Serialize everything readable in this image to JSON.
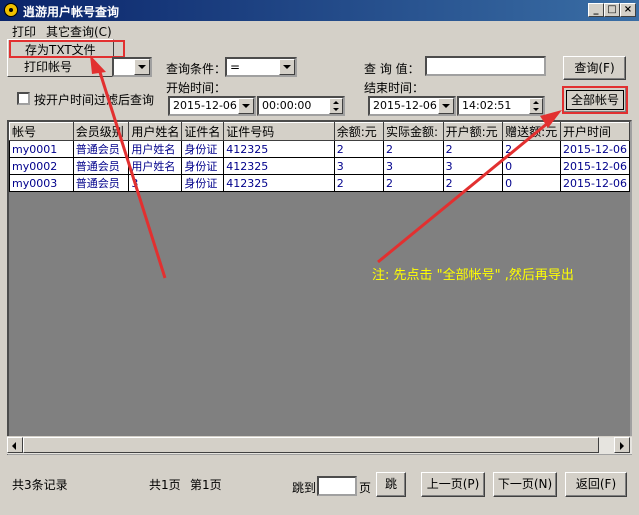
{
  "window": {
    "title": "逍游用户帐号查询",
    "min": "_",
    "max": "□",
    "close": "×"
  },
  "menu": [
    {
      "label": "打印"
    },
    {
      "label": "其它查询(C)"
    }
  ],
  "print_menu": [
    {
      "label": "存为TXT文件"
    },
    {
      "label": "打印帐号"
    }
  ],
  "query": {
    "condition_label": "查询条件：",
    "condition_value": "=",
    "value_label": "查 询 值：",
    "value_text": "",
    "query_button": "查询(F)",
    "all_accounts_button": "全部帐号",
    "filter_checkbox_label": "按开户时间过滤后查询",
    "start_label": "开始时间：",
    "start_date": "2015-12-06",
    "start_time": "00:00:00",
    "end_label": "结束时间：",
    "end_date": "2015-12-06",
    "end_time": "14:02:51"
  },
  "table": {
    "columns": [
      "帐号",
      "会员级别",
      "用户姓名",
      "证件名",
      "证件号码",
      "余额:元",
      "实际金额:",
      "开户额:元",
      "赠送额:元",
      "开户时间"
    ],
    "rows": [
      [
        "my0001",
        "普通会员",
        "用户姓名",
        "身份证",
        "412325",
        "2",
        "2",
        "2",
        "2",
        "2015-12-06"
      ],
      [
        "my0002",
        "普通会员",
        "用户姓名",
        "身份证",
        "412325",
        "3",
        "3",
        "3",
        "0",
        "2015-12-06"
      ],
      [
        "my0003",
        "普通会员",
        "3",
        "身份证",
        "412325",
        "2",
        "2",
        "2",
        "0",
        "2015-12-06"
      ]
    ]
  },
  "annotation": "注: 先点击 \"全部帐号\" ,然后再导出",
  "footer": {
    "record_count": "共3条记录",
    "page_total": "共1页",
    "page_current": "第1页",
    "jump_label": "跳到",
    "page_unit": "页",
    "jump_button": "跳",
    "prev_button": "上一页(P)",
    "next_button": "下一页(N)",
    "back_button": "返回(F)"
  },
  "colors": {
    "annotation_arrow": "#e23030",
    "annotation_text": "#ffff00",
    "titlebar": "#0a246a"
  }
}
